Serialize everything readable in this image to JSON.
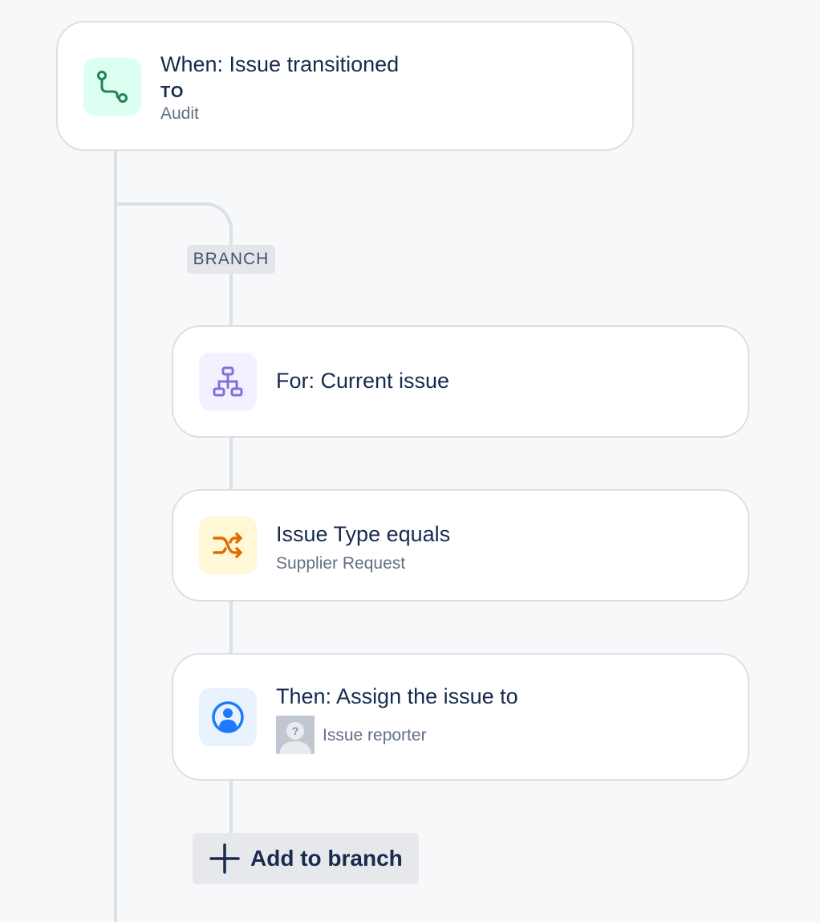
{
  "trigger": {
    "title": "When: Issue transitioned",
    "to_label": "TO",
    "status": "Audit",
    "icon": "transition-icon",
    "color": "#1f845a"
  },
  "branch": {
    "label": "BRANCH"
  },
  "for_step": {
    "title": "For: Current issue",
    "icon": "hierarchy-icon",
    "color": "#8270db"
  },
  "condition_step": {
    "title": "Issue Type equals",
    "value": "Supplier Request",
    "icon": "shuffle-icon",
    "color": "#e06c00"
  },
  "action_step": {
    "title": "Then: Assign the issue to",
    "value": "Issue reporter",
    "icon": "user-circle-icon",
    "color": "#1d7afc"
  },
  "add_button": {
    "label": "Add to branch"
  }
}
